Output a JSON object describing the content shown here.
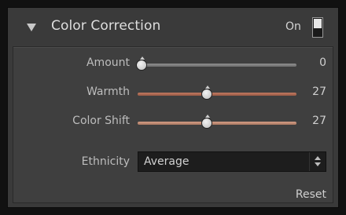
{
  "panel": {
    "title": "Color Correction",
    "toggle_label": "On",
    "toggle_state": "on",
    "collapse_icon": "triangle-down-icon"
  },
  "sliders": [
    {
      "label": "Amount",
      "value": "0",
      "range": [
        -100,
        100
      ],
      "track_color": "#7f7f7f"
    },
    {
      "label": "Warmth",
      "value": "27",
      "range": [
        -100,
        100
      ],
      "track_color": "#b06a52"
    },
    {
      "label": "Color Shift",
      "value": "27",
      "range": [
        -100,
        100
      ],
      "track_color": "#c08a72"
    }
  ],
  "ethnicity": {
    "label": "Ethnicity",
    "selected": "Average",
    "icon": "up-down-arrows-icon"
  },
  "reset_label": "Reset",
  "colors": {
    "panel_bg": "#3a3a3a",
    "content_bg": "#3f3f3f",
    "text": "#d0d0d0"
  }
}
